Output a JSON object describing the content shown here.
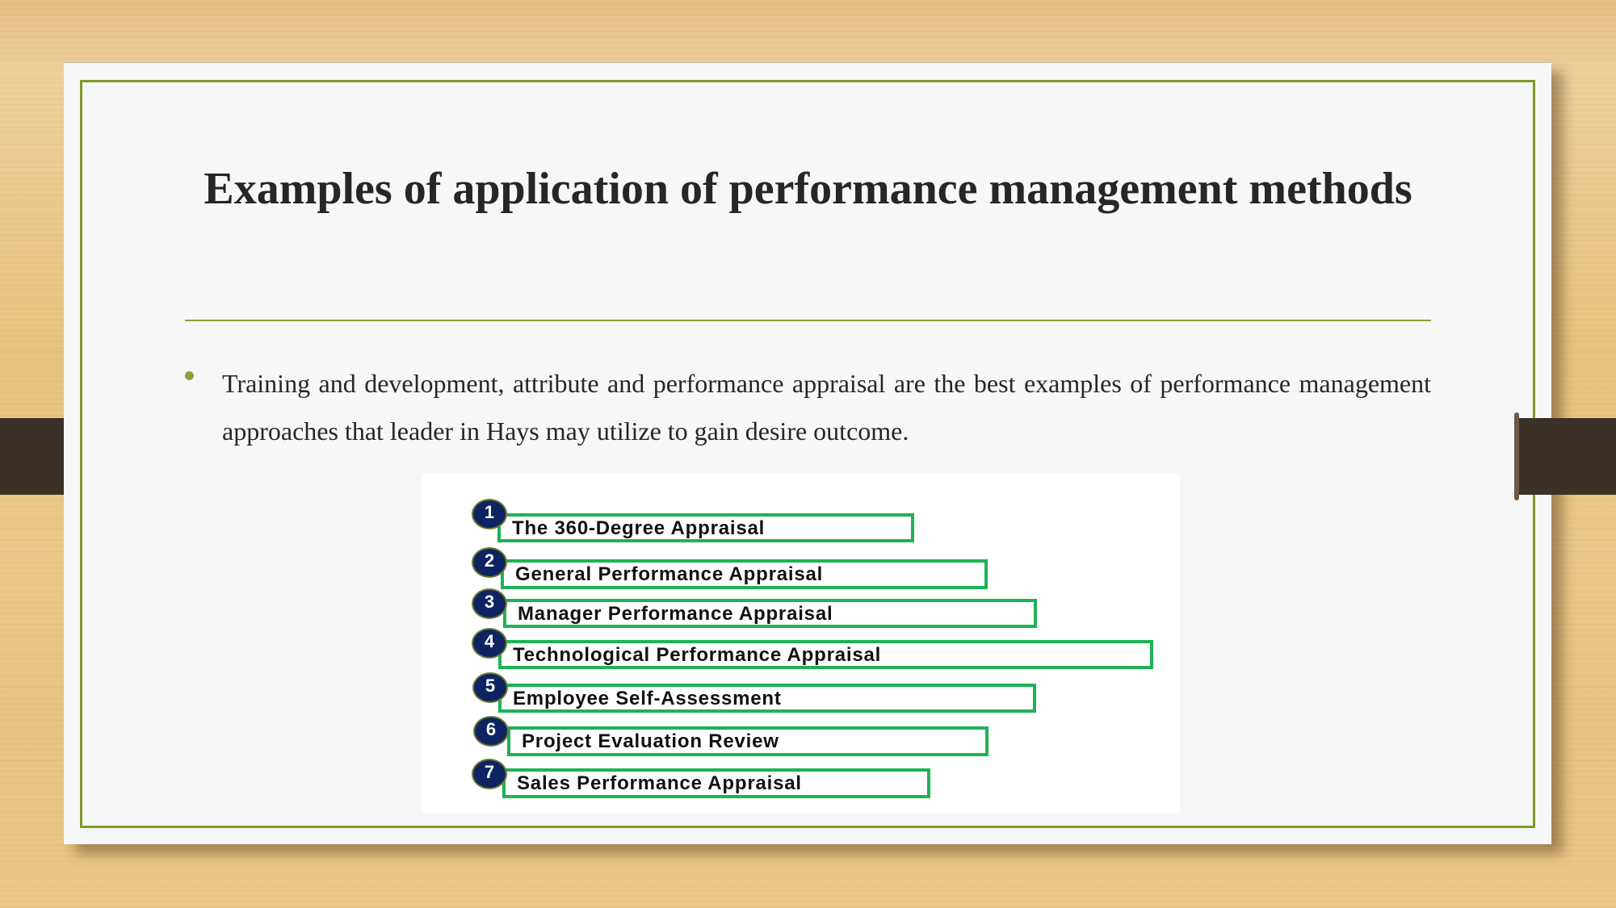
{
  "slide": {
    "title": "Examples of application of performance management methods",
    "bullets": [
      "Training and development, attribute and performance appraisal are the best examples of performance management approaches that leader in Hays may utilize to gain desire outcome."
    ],
    "colors": {
      "accent": "#7f9a2c",
      "bullet": "#8aa13a",
      "text": "#262626",
      "clip": "#3c3127",
      "card": "#f7f7f7"
    }
  },
  "figure": {
    "items": [
      {
        "number": "1",
        "label": "The 360-Degree Appraisal"
      },
      {
        "number": "2",
        "label": "General Performance Appraisal"
      },
      {
        "number": "3",
        "label": "Manager Performance Appraisal"
      },
      {
        "number": "4",
        "label": "Technological Performance Appraisal"
      },
      {
        "number": "5",
        "label": "Employee Self-Assessment"
      },
      {
        "number": "6",
        "label": "Project Evaluation Review"
      },
      {
        "number": "7",
        "label": "Sales Performance Appraisal"
      }
    ],
    "colors": {
      "box_border": "#1db355",
      "number_circle": "#0e2462"
    }
  }
}
